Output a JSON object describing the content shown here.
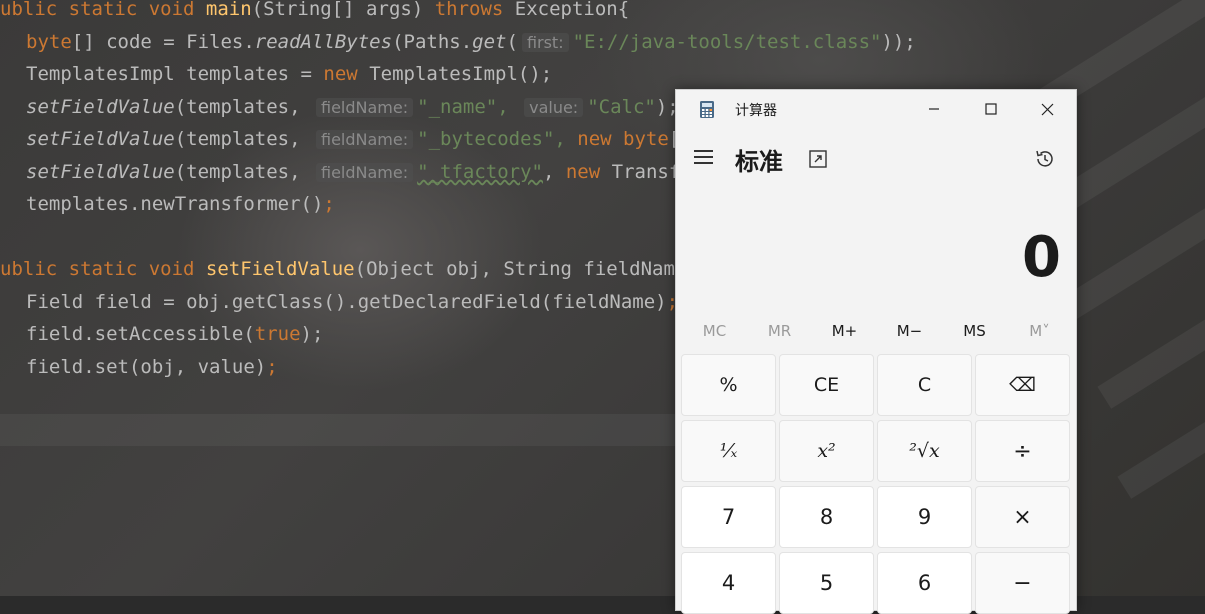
{
  "editor": {
    "line1": {
      "pre": "ublic static void ",
      "fn": "main",
      "args": "(String[] args) ",
      "throws": "throws",
      "post": " Exception{"
    },
    "line2": {
      "kw": "byte",
      "a": "[] code = Files.",
      "fn": "readAllBytes",
      "b": "(Paths.",
      "fn2": "get",
      "c": "(",
      "hint": "first:",
      "str": "\"E://java-tools/test.class\"",
      "d": "));"
    },
    "line3": {
      "a": "TemplatesImpl templates = ",
      "kw": "new",
      "b": " TemplatesImpl();"
    },
    "line4": {
      "fn": "setFieldValue",
      "a": "(templates, ",
      "hint1": "fieldName:",
      "str1": "\"_name\",",
      "hint2": "value:",
      "str2": "\"Calc\"",
      "b": ");"
    },
    "line5": {
      "fn": "setFieldValue",
      "a": "(templates, ",
      "hint": "fieldName:",
      "str": "\"_bytecodes\",",
      "kw": " new byte",
      "b": "[]"
    },
    "line6": {
      "fn": "setFieldValue",
      "a": "(templates, ",
      "hint": "fieldName:",
      "str": "\"_tfactory\"",
      "b": ", ",
      "kw": "new",
      "c": " Transfo"
    },
    "line7": {
      "a": "templates.newTransformer()",
      "b": ";"
    },
    "line8": {
      "pre": "ublic static void ",
      "fn": "setFieldValue",
      "args": "(Object obj, String fieldName,"
    },
    "line9": {
      "a": "Field field = obj.getClass().getDeclaredField(fieldName)",
      "b": ";"
    },
    "line10": {
      "a": "field.setAccessible(",
      "kw": "true",
      "b": ");"
    },
    "line11": {
      "a": "field.set(obj, value)",
      "b": ";"
    }
  },
  "calculator": {
    "window_title": "计算器",
    "mode_title": "标准",
    "display_value": "0",
    "memory_buttons": [
      {
        "label": "MC",
        "enabled": false
      },
      {
        "label": "MR",
        "enabled": false
      },
      {
        "label": "M+",
        "enabled": true
      },
      {
        "label": "M−",
        "enabled": true
      },
      {
        "label": "MS",
        "enabled": true
      },
      {
        "label": "M˅",
        "enabled": false
      }
    ],
    "keys": [
      [
        "%",
        "CE",
        "C",
        "⌫"
      ],
      [
        "¹⁄ₓ",
        "x²",
        "²√x",
        "÷"
      ],
      [
        "7",
        "8",
        "9",
        "×"
      ],
      [
        "4",
        "5",
        "6",
        "−"
      ]
    ]
  },
  "colors": {
    "keyword": "#cc7832",
    "function": "#ffc66d",
    "string": "#6a8759",
    "text": "#bbbbbb"
  }
}
